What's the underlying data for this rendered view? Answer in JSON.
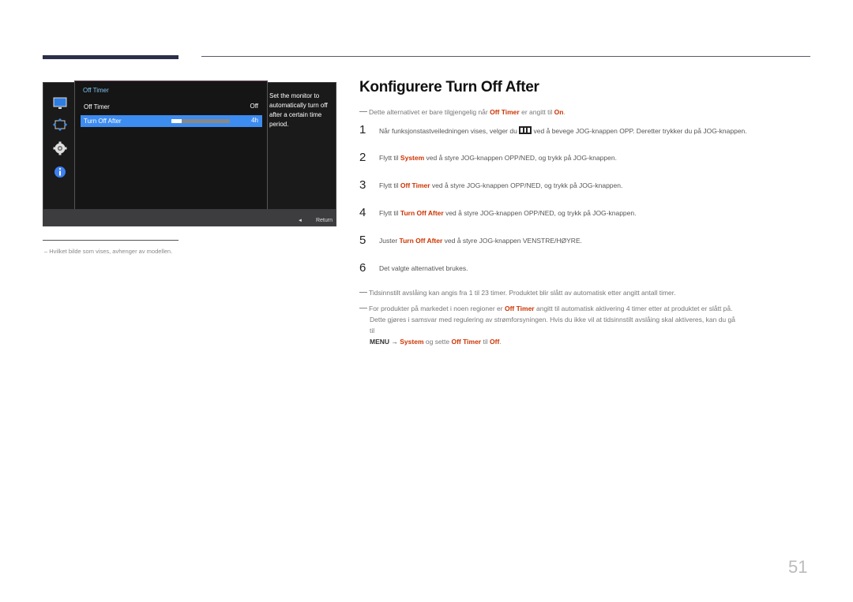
{
  "osd": {
    "panel_title": "Off Timer",
    "rows": [
      {
        "label": "Off Timer",
        "value": "Off"
      },
      {
        "label": "Turn Off After",
        "value": "4h",
        "slider_fraction": 0.17
      }
    ],
    "description": "Set the monitor to automatically turn off after a certain time period.",
    "return_label": "Return",
    "icons": [
      "monitor-icon",
      "resize-icon",
      "gear-icon",
      "info-icon"
    ]
  },
  "caption": "Hvilket bilde som vises, avhenger av modellen.",
  "heading": "Konfigurere Turn Off After",
  "note_top": {
    "pre": "Dette alternativet er bare tilgjengelig når ",
    "hl1": "Off Timer",
    "mid": " er angitt til ",
    "hl2": "On",
    "post": "."
  },
  "steps": [
    {
      "num": "1",
      "pre": "Når funksjonstastveiledningen vises, velger du ",
      "hl": "",
      "post": " ved å bevege JOG-knappen OPP. Deretter trykker du på JOG-knappen."
    },
    {
      "num": "2",
      "pre": "Flytt til ",
      "hl": "System",
      "post": " ved å styre JOG-knappen OPP/NED, og trykk på JOG-knappen."
    },
    {
      "num": "3",
      "pre": "Flytt til ",
      "hl": "Off Timer",
      "post": " ved å styre JOG-knappen OPP/NED, og trykk på JOG-knappen."
    },
    {
      "num": "4",
      "pre": "Flytt til ",
      "hl": "Turn Off After",
      "post": " ved å styre JOG-knappen OPP/NED, og trykk på JOG-knappen."
    },
    {
      "num": "5",
      "pre": "Juster ",
      "hl": "Turn Off After",
      "post": " ved å styre JOG-knappen VENSTRE/HØYRE."
    },
    {
      "num": "6",
      "pre": "Det valgte alternativet brukes.",
      "hl": "",
      "post": ""
    }
  ],
  "note2": "Tidsinnstilt avslåing kan angis fra 1 til 23 timer. Produktet blir slått av automatisk etter angitt antall timer.",
  "note3": {
    "pre": "For produkter på markedet i noen regioner er ",
    "hl1": "Off Timer",
    "mid": " angitt til automatisk aktivering 4 timer etter at produktet er slått på.",
    "line2": "Dette gjøres i samsvar med regulering av strømforsyningen. Hvis du ikke vil at tidsinnstilt avslåing skal aktiveres, kan du gå",
    "line3": "til",
    "menu": "MENU →",
    "hl2": "System",
    "mid2": " og sette ",
    "hl3": "Off Timer",
    "mid3": " til ",
    "hl4": "Off",
    "end": "."
  },
  "page_number": "51",
  "colors": {
    "highlight": "#cc3300",
    "osd_selected": "#3d8cf0",
    "osd_title": "#7fc3f0"
  }
}
